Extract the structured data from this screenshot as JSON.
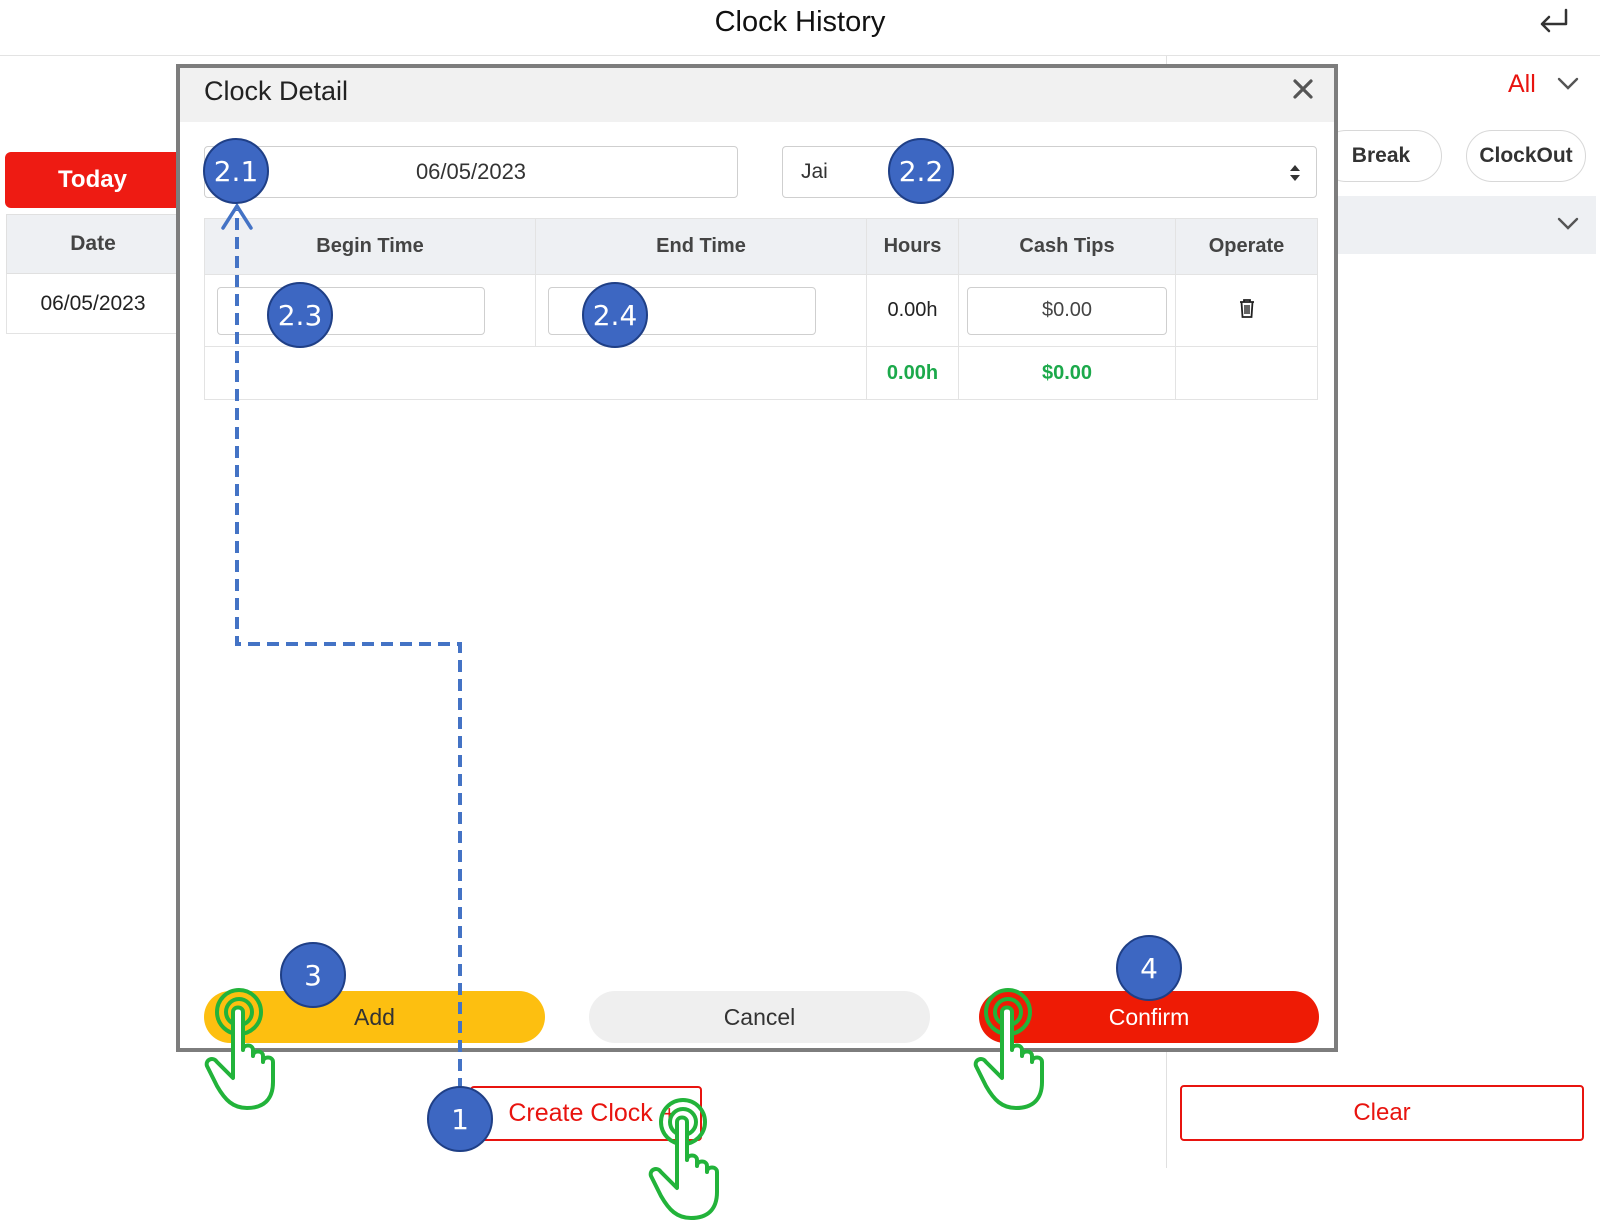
{
  "header": {
    "title": "Clock History"
  },
  "left": {
    "today_label": "Today",
    "date_column": "Date",
    "date_value": "06/05/2023"
  },
  "right": {
    "filter_value": "All",
    "chips": {
      "break": "Break",
      "clockout": "ClockOut"
    },
    "clear_label": "Clear"
  },
  "create_clock": {
    "label": "Create Clock",
    "plus": "+"
  },
  "modal": {
    "title": "Clock Detail",
    "date": "06/05/2023",
    "employee": "Jai",
    "columns": {
      "begin": "Begin Time",
      "end": "End Time",
      "hours": "Hours",
      "tips": "Cash Tips",
      "operate": "Operate"
    },
    "row": {
      "hours": "0.00h",
      "tips": "$0.00"
    },
    "total": {
      "hours": "0.00h",
      "tips": "$0.00"
    },
    "buttons": {
      "add": "Add",
      "cancel": "Cancel",
      "confirm": "Confirm"
    }
  },
  "steps": {
    "s1": "1",
    "s21": "2.1",
    "s22": "2.2",
    "s23": "2.3",
    "s24": "2.4",
    "s3": "3",
    "s4": "4"
  },
  "colors": {
    "accent_red": "#ee1b13",
    "add_yellow": "#fdbf10",
    "step_blue": "#3d67c2",
    "hand_green": "#22b33a",
    "total_green": "#1ca94b"
  }
}
